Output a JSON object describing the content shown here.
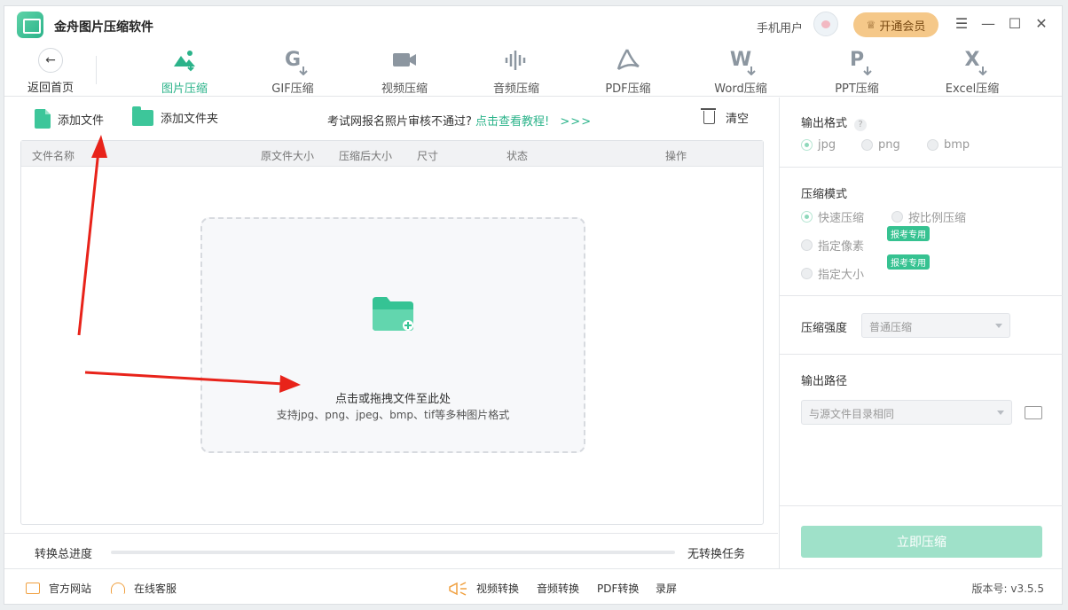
{
  "app": {
    "title": "金舟图片压缩软件"
  },
  "header": {
    "user_name": "手机用户",
    "vip_label": "开通会员"
  },
  "nav": {
    "back_label": "返回首页",
    "tools": [
      {
        "label": "图片压缩",
        "icon": "image-compress-icon",
        "active": true
      },
      {
        "label": "GIF压缩",
        "icon": "gif-compress-icon",
        "active": false
      },
      {
        "label": "视频压缩",
        "icon": "video-compress-icon",
        "active": false
      },
      {
        "label": "音频压缩",
        "icon": "audio-compress-icon",
        "active": false
      },
      {
        "label": "PDF压缩",
        "icon": "pdf-compress-icon",
        "active": false
      },
      {
        "label": "Word压缩",
        "icon": "word-compress-icon",
        "active": false
      },
      {
        "label": "PPT压缩",
        "icon": "ppt-compress-icon",
        "active": false
      },
      {
        "label": "Excel压缩",
        "icon": "excel-compress-icon",
        "active": false
      }
    ]
  },
  "actions": {
    "add_file": "添加文件",
    "add_folder": "添加文件夹",
    "promo_text": "考试网报名照片审核不通过?",
    "promo_link": "点击查看教程!",
    "promo_chevrons": ">>>",
    "clear": "清空"
  },
  "table": {
    "columns": [
      "文件名称",
      "原文件大小",
      "压缩后大小",
      "尺寸",
      "状态",
      "操作"
    ]
  },
  "dropzone": {
    "title": "点击或拖拽文件至此处",
    "subtitle": "支持jpg、png、jpeg、bmp、tif等多种图片格式"
  },
  "progress": {
    "label": "转换总进度",
    "value": 0,
    "status": "无转换任务"
  },
  "settings": {
    "format": {
      "title": "输出格式",
      "help": "?",
      "options": [
        "jpg",
        "png",
        "bmp"
      ],
      "selected": "jpg"
    },
    "mode": {
      "title": "压缩模式",
      "options": [
        "快速压缩",
        "按比例压缩",
        "指定像素",
        "指定大小"
      ],
      "selected": "快速压缩",
      "badge": "报考专用"
    },
    "strength": {
      "title": "压缩强度",
      "value": "普通压缩"
    },
    "output": {
      "title": "输出路径",
      "value": "与源文件目录相同"
    },
    "start_label": "立即压缩"
  },
  "footer": {
    "website": "官方网站",
    "support": "在线客服",
    "links": [
      "视频转换",
      "音频转换",
      "PDF转换",
      "录屏"
    ],
    "version": "版本号: v3.5.5"
  },
  "colors": {
    "accent": "#2bb38a",
    "vip": "#f5c889",
    "arrow": "#e8231a"
  }
}
